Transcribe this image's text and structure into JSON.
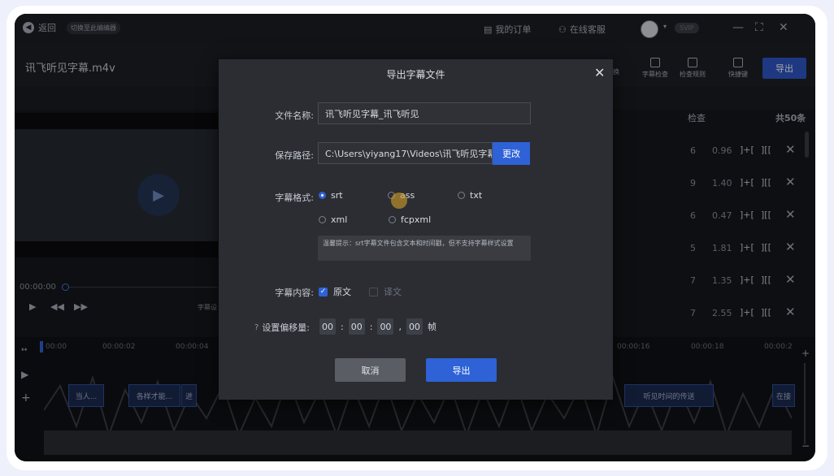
{
  "titlebar": {
    "back": "返回",
    "switch_editor": "切换至此编编器",
    "my_orders": "我的订单",
    "online_service": "在线客服",
    "svip": "SVIP",
    "min": "—",
    "max": "⛶",
    "close": "✕"
  },
  "toolbar": {
    "filename": "讯飞听见字幕.m4v",
    "tool_suffix": "换",
    "tools": [
      "字幕检查",
      "检查规则",
      "快捷键"
    ],
    "export": "导出"
  },
  "list": {
    "header_check": "检查",
    "header_count": "共50条",
    "rows": [
      {
        "n": "6",
        "d": "0.96"
      },
      {
        "n": "9",
        "d": "1.40"
      },
      {
        "n": "6",
        "d": "0.47"
      },
      {
        "n": "5",
        "d": "1.81"
      },
      {
        "n": "7",
        "d": "1.35"
      },
      {
        "n": "7",
        "d": "2.55"
      }
    ],
    "merge_prev": "]+[",
    "merge_next": "][[",
    "delete": "✕"
  },
  "player": {
    "time": "00:00:00",
    "sub_setting": "字幕设"
  },
  "timeline": {
    "ticks": [
      "00:00",
      "00:00:02",
      "00:00:04",
      "00:00:16",
      "00:00:18",
      "00:00:2"
    ],
    "clips": [
      "当人...",
      "各样才能...",
      "进",
      "听见时间的传送",
      "在接"
    ]
  },
  "dialog": {
    "title": "导出字幕文件",
    "close": "✕",
    "filename_label": "文件名称:",
    "filename_value": "讯飞听见字幕_讯飞听见",
    "path_label": "保存路径:",
    "path_value": "C:\\Users\\yiyang17\\Videos\\讯飞听见字幕",
    "change_button": "更改",
    "format_label": "字幕格式:",
    "formats": [
      {
        "label": "srt",
        "selected": true
      },
      {
        "label": "ass",
        "selected": false
      },
      {
        "label": "txt",
        "selected": false
      },
      {
        "label": "xml",
        "selected": false
      },
      {
        "label": "fcpxml",
        "selected": false
      }
    ],
    "hint": "温馨提示：srt字幕文件包含文本和时间戳，但不支持字幕样式设置",
    "content_label": "字幕内容:",
    "content_original": "原文",
    "content_translation": "译文",
    "offset_label": "设置偏移量:",
    "offset": [
      "00",
      "00",
      "00",
      "00"
    ],
    "offset_unit": "帧",
    "cancel": "取消",
    "export": "导出"
  },
  "colors": {
    "accent": "#2e62d6",
    "background": "#15171c",
    "dialog": "#2b2d33"
  }
}
